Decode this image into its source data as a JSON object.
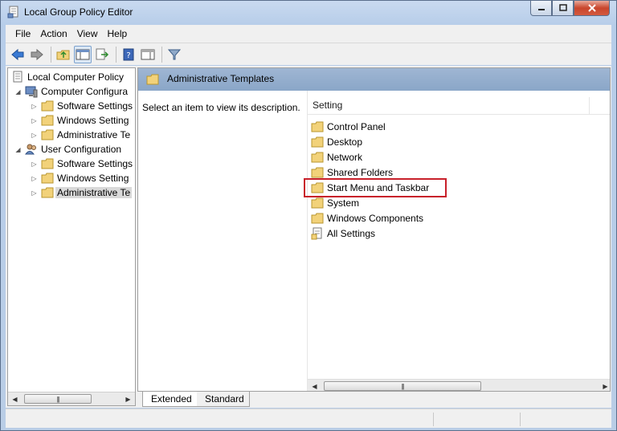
{
  "window": {
    "title": "Local Group Policy Editor"
  },
  "menu": [
    {
      "label": "File"
    },
    {
      "label": "Action"
    },
    {
      "label": "View"
    },
    {
      "label": "Help"
    }
  ],
  "toolbar": {
    "icons": [
      "back-arrow-icon",
      "forward-arrow-icon",
      "up-folder-icon",
      "show-hide-console-tree-icon",
      "export-list-icon",
      "help-icon",
      "show-action-pane-icon",
      "filter-icon"
    ]
  },
  "tree": {
    "items": [
      {
        "label": "Local Computer Policy"
      },
      {
        "label": "Computer Configura"
      },
      {
        "label": "Software Settings"
      },
      {
        "label": "Windows Setting"
      },
      {
        "label": "Administrative Te"
      },
      {
        "label": "User Configuration"
      },
      {
        "label": "Software Settings"
      },
      {
        "label": "Windows Setting"
      },
      {
        "label": "Administrative Te"
      }
    ]
  },
  "main": {
    "header_title": "Administrative Templates",
    "description": "Select an item to view its description.",
    "column_header": "Setting",
    "items": [
      {
        "label": "Control Panel"
      },
      {
        "label": "Desktop"
      },
      {
        "label": "Network"
      },
      {
        "label": "Shared Folders"
      },
      {
        "label": "Start Menu and Taskbar"
      },
      {
        "label": "System"
      },
      {
        "label": "Windows Components"
      },
      {
        "label": "All Settings"
      }
    ],
    "highlighted_item": "Start Menu and Taskbar"
  },
  "tabs": [
    {
      "label": "Extended"
    },
    {
      "label": "Standard"
    }
  ],
  "colors": {
    "highlight_border": "#c8202a",
    "header_band": "#8aa6c8",
    "folder": "#f2d27a"
  }
}
